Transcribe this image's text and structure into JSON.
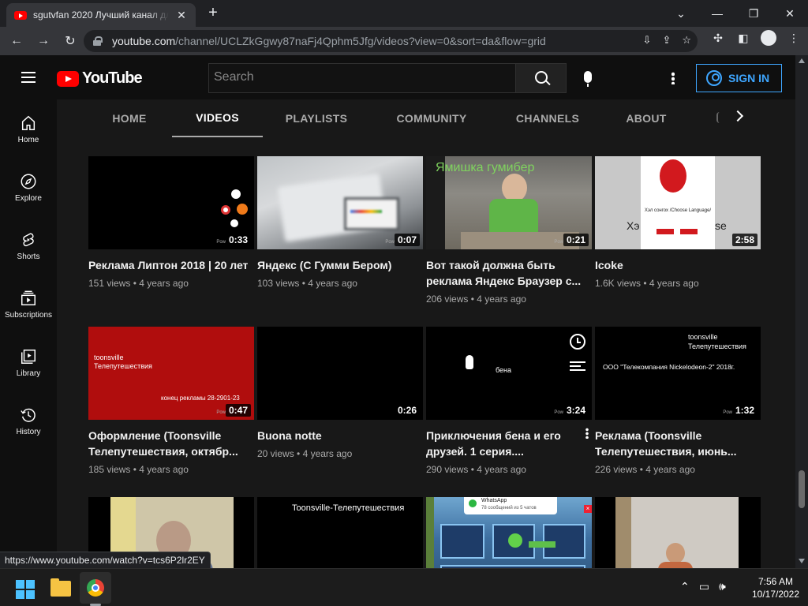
{
  "browser": {
    "tab_title": "sgutvfan 2020 Лучший канал для",
    "tab_close": "✕",
    "new_tab": "+",
    "window_controls": [
      "⌄",
      "—",
      "❐",
      "✕"
    ],
    "nav": {
      "back": "←",
      "forward": "→",
      "reload": "↻"
    },
    "url_host": "youtube.com",
    "url_path": "/channel/UCLZkGgwy87naFj4Qphm5Jfg/videos?view=0&sort=da&flow=grid",
    "status_url": "https://www.youtube.com/watch?v=tcs6P2lr2EY"
  },
  "youtube": {
    "logo_text": "YouTube",
    "search_placeholder": "Search",
    "sign_in": "SIGN IN",
    "guide": [
      {
        "label": "Home",
        "icon": "home-icon"
      },
      {
        "label": "Explore",
        "icon": "compass-icon"
      },
      {
        "label": "Shorts",
        "icon": "shorts-icon"
      },
      {
        "label": "Subscriptions",
        "icon": "subscriptions-icon"
      },
      {
        "label": "Library",
        "icon": "library-icon"
      },
      {
        "label": "History",
        "icon": "history-icon"
      }
    ],
    "tabs": [
      "HOME",
      "VIDEOS",
      "PLAYLISTS",
      "COMMUNITY",
      "CHANNELS",
      "ABOUT"
    ],
    "active_tab": "VIDEOS",
    "videos": [
      {
        "title": "Реклама Липтон 2018 | 20 лет",
        "views": "151 views",
        "age": "4 years ago",
        "duration": "0:33"
      },
      {
        "title": "Яндекс (С Гумми Бером)",
        "views": "103 views",
        "age": "4 years ago",
        "duration": "0:07"
      },
      {
        "title": "Вот такой должна быть реклама Яндекс Браузер с...",
        "views": "206 views",
        "age": "4 years ago",
        "duration": "0:21"
      },
      {
        "title": "Icoke",
        "views": "1.6K views",
        "age": "4 years ago",
        "duration": "2:58"
      },
      {
        "title": "Оформление (Toonsville Телепутешествия, октябр...",
        "views": "185 views",
        "age": "4 years ago",
        "duration": "0:47"
      },
      {
        "title": "Buona notte",
        "views": "20 views",
        "age": "4 years ago",
        "duration": "0:26"
      },
      {
        "title": "Приключения бена и его друзей. 1 серия....",
        "views": "290 views",
        "age": "4 years ago",
        "duration": "3:24"
      },
      {
        "title": "Реклама (Toonsville Телепутешествия, июнь...",
        "views": "226 views",
        "age": "4 years ago",
        "duration": "1:32"
      }
    ],
    "thumb_texts": {
      "t3": "Ямишка гумибер",
      "t4_a": "Хэл сонгох /Choose Language/",
      "t4_b": "Хэ",
      "t4_c": "se",
      "t5_a": "toonsville",
      "t5_b": "Телепутешествия",
      "t5_c": "конец рекламы 28-2901-23",
      "t7": "бена",
      "t8_a": "toonsville",
      "t8_b": "Телепутешествия",
      "t8_c": "ООО \"Телекомпания Nickelodeon-2\" 2018г.",
      "t10": "Toonsville-Телепутешествия",
      "t11_a": "WhatsApp",
      "t11_b": "78 сообщений из 5 чатов",
      "pow": "Pow"
    }
  },
  "taskbar": {
    "time": "7:56 AM",
    "date": "10/17/2022"
  },
  "colors": {
    "accent": "#3ea6ff",
    "yt_red": "#ff0000",
    "bg": "#0f0f0f",
    "grid_bg": "#181818"
  }
}
